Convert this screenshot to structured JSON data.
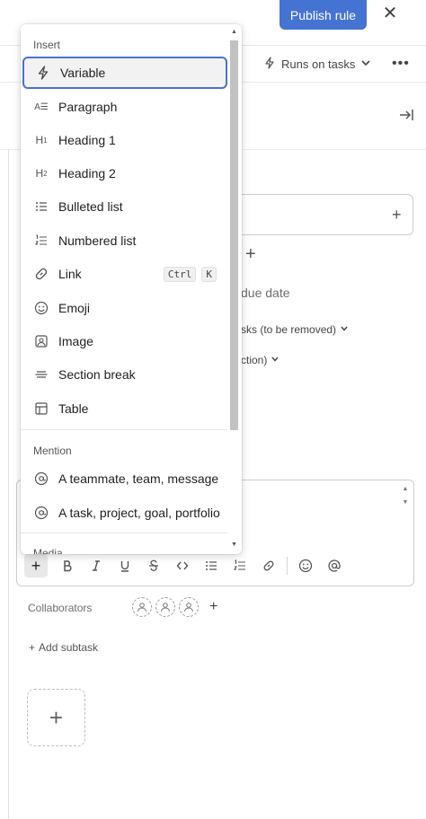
{
  "header": {
    "publish_label": "Publish rule",
    "runs_label": "Runs on tasks"
  },
  "task": {
    "due_label": "due date",
    "tasks_removed_label": "sks (to be removed)",
    "ction_label": "ction)",
    "collaborators_label": "Collaborators",
    "add_subtask_label": "Add subtask"
  },
  "menu": {
    "insert_heading": "Insert",
    "mention_heading": "Mention",
    "media_heading": "Media",
    "items": [
      {
        "label": "Variable",
        "icon": "lightning-icon",
        "selected": true
      },
      {
        "label": "Paragraph",
        "icon": "paragraph-icon"
      },
      {
        "label": "Heading 1",
        "icon": "heading1-icon"
      },
      {
        "label": "Heading 2",
        "icon": "heading2-icon"
      },
      {
        "label": "Bulleted list",
        "icon": "bulleted-list-icon"
      },
      {
        "label": "Numbered list",
        "icon": "numbered-list-icon"
      },
      {
        "label": "Link",
        "icon": "link-icon",
        "shortcut": [
          "Ctrl",
          "K"
        ]
      },
      {
        "label": "Emoji",
        "icon": "emoji-icon"
      },
      {
        "label": "Image",
        "icon": "image-icon"
      },
      {
        "label": "Section break",
        "icon": "section-break-icon"
      },
      {
        "label": "Table",
        "icon": "table-icon"
      }
    ],
    "mentions": [
      {
        "label": "A teammate, team, message",
        "icon": "at-icon"
      },
      {
        "label": "A task, project, goal, portfolio",
        "icon": "at-icon"
      }
    ]
  },
  "colors": {
    "accent": "#4573d2",
    "selected_bg": "#f2f2f2"
  }
}
